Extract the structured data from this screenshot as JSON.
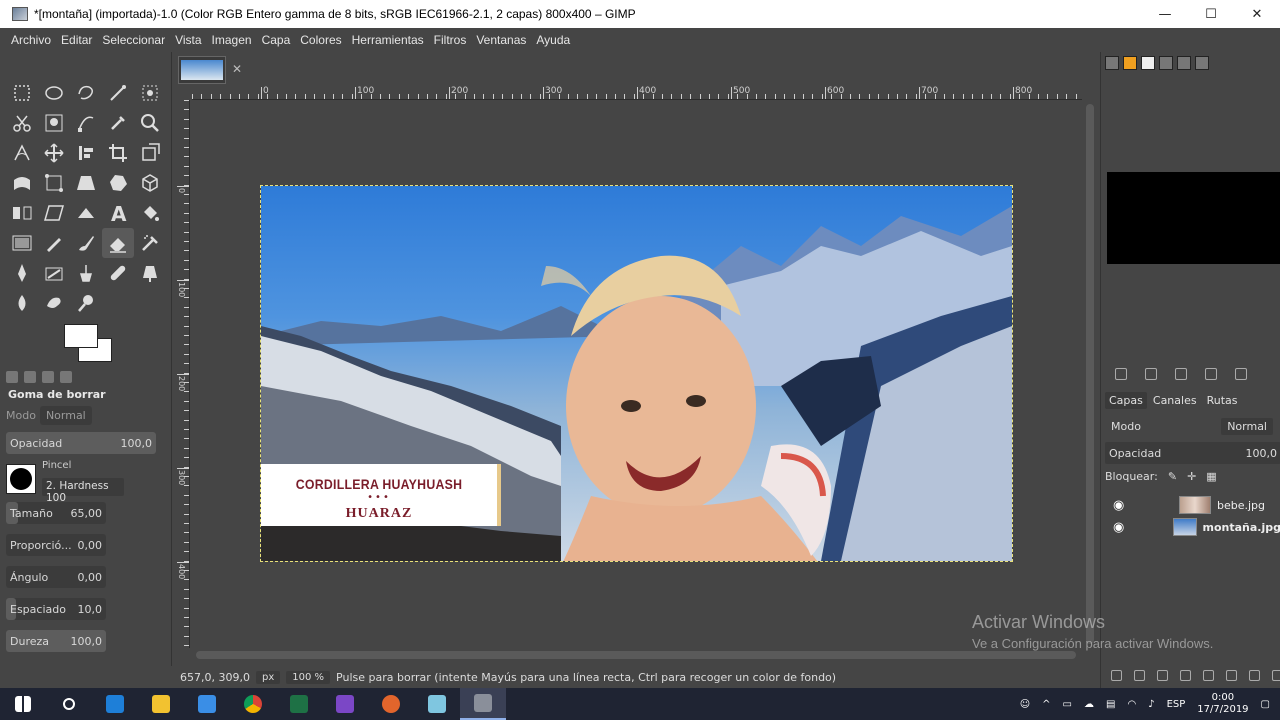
{
  "window": {
    "title": "*[montaña] (importada)-1.0 (Color RGB Entero gamma de 8 bits, sRGB IEC61966-2.1, 2 capas) 800x400 – GIMP",
    "minimize": "—",
    "maximize": "☐",
    "close": "✕"
  },
  "menu": [
    "Archivo",
    "Editar",
    "Seleccionar",
    "Vista",
    "Imagen",
    "Capa",
    "Colores",
    "Herramientas",
    "Filtros",
    "Ventanas",
    "Ayuda"
  ],
  "tools": [
    "rect-select",
    "ellipse-select",
    "free-select",
    "fuzzy-select",
    "by-color-select",
    "scissors",
    "foreground-select",
    "paths",
    "color-picker",
    "zoom",
    "measure",
    "move",
    "align",
    "crop",
    "unified-transform",
    "warp",
    "handle-transform",
    "perspective",
    "cage",
    "3d-transform",
    "flip",
    "shear",
    "gradient",
    "text",
    "bucket-fill",
    "blend",
    "pencil",
    "paintbrush",
    "eraser",
    "airbrush",
    "ink",
    "mypaint",
    "clone",
    "heal",
    "perspective-clone",
    "blur",
    "smudge",
    "dodge"
  ],
  "tool_options": {
    "title": "Goma de borrar",
    "mode_label": "Modo",
    "mode_value": "Normal",
    "opacity_label": "Opacidad",
    "opacity_value": "100,0",
    "brush_label": "Pincel",
    "brush_name": "2. Hardness 100",
    "size_label": "Tamaño",
    "size_value": "65,00",
    "ratio_label": "Proporció...",
    "ratio_value": "0,00",
    "angle_label": "Ángulo",
    "angle_value": "0,00",
    "spacing_label": "Espaciado",
    "spacing_value": "10,0",
    "hardness_label": "Dureza",
    "hardness_value": "100,0"
  },
  "ruler": {
    "labels": [
      "0",
      "100",
      "200",
      "300",
      "400",
      "500",
      "600",
      "700",
      "800"
    ],
    "vlabels": [
      "0",
      "100",
      "200",
      "300",
      "400"
    ]
  },
  "image": {
    "banner_title": "CORDILLERA HUAYHUASH",
    "banner_dots": "•••",
    "banner_sub": "HUARAZ"
  },
  "status": {
    "coords": "657,0, 309,0",
    "unit": "px",
    "zoom": "100 %",
    "message": "Pulse para borrar (intente Mayús para una línea recta, Ctrl para recoger un color de fondo)"
  },
  "layers_panel": {
    "tabs": [
      "Capas",
      "Canales",
      "Rutas"
    ],
    "mode_label": "Modo",
    "mode_value": "Normal",
    "opacity_label": "Opacidad",
    "opacity_value": "100,0",
    "lock_label": "Bloquear:",
    "layers": [
      {
        "name": "bebe.jpg",
        "visible": true
      },
      {
        "name": "montaña.jpg",
        "visible": true
      }
    ]
  },
  "watermark": {
    "line1": "Activar Windows",
    "line2": "Ve a Configuración para activar Windows."
  },
  "taskbar": {
    "lang": "ESP",
    "time": "0:00",
    "date": "17/7/2019"
  },
  "colors": {
    "accent_fg": "#ffffff",
    "accent_bg": "#ffffff",
    "banner_text": "#7a1d2a"
  }
}
